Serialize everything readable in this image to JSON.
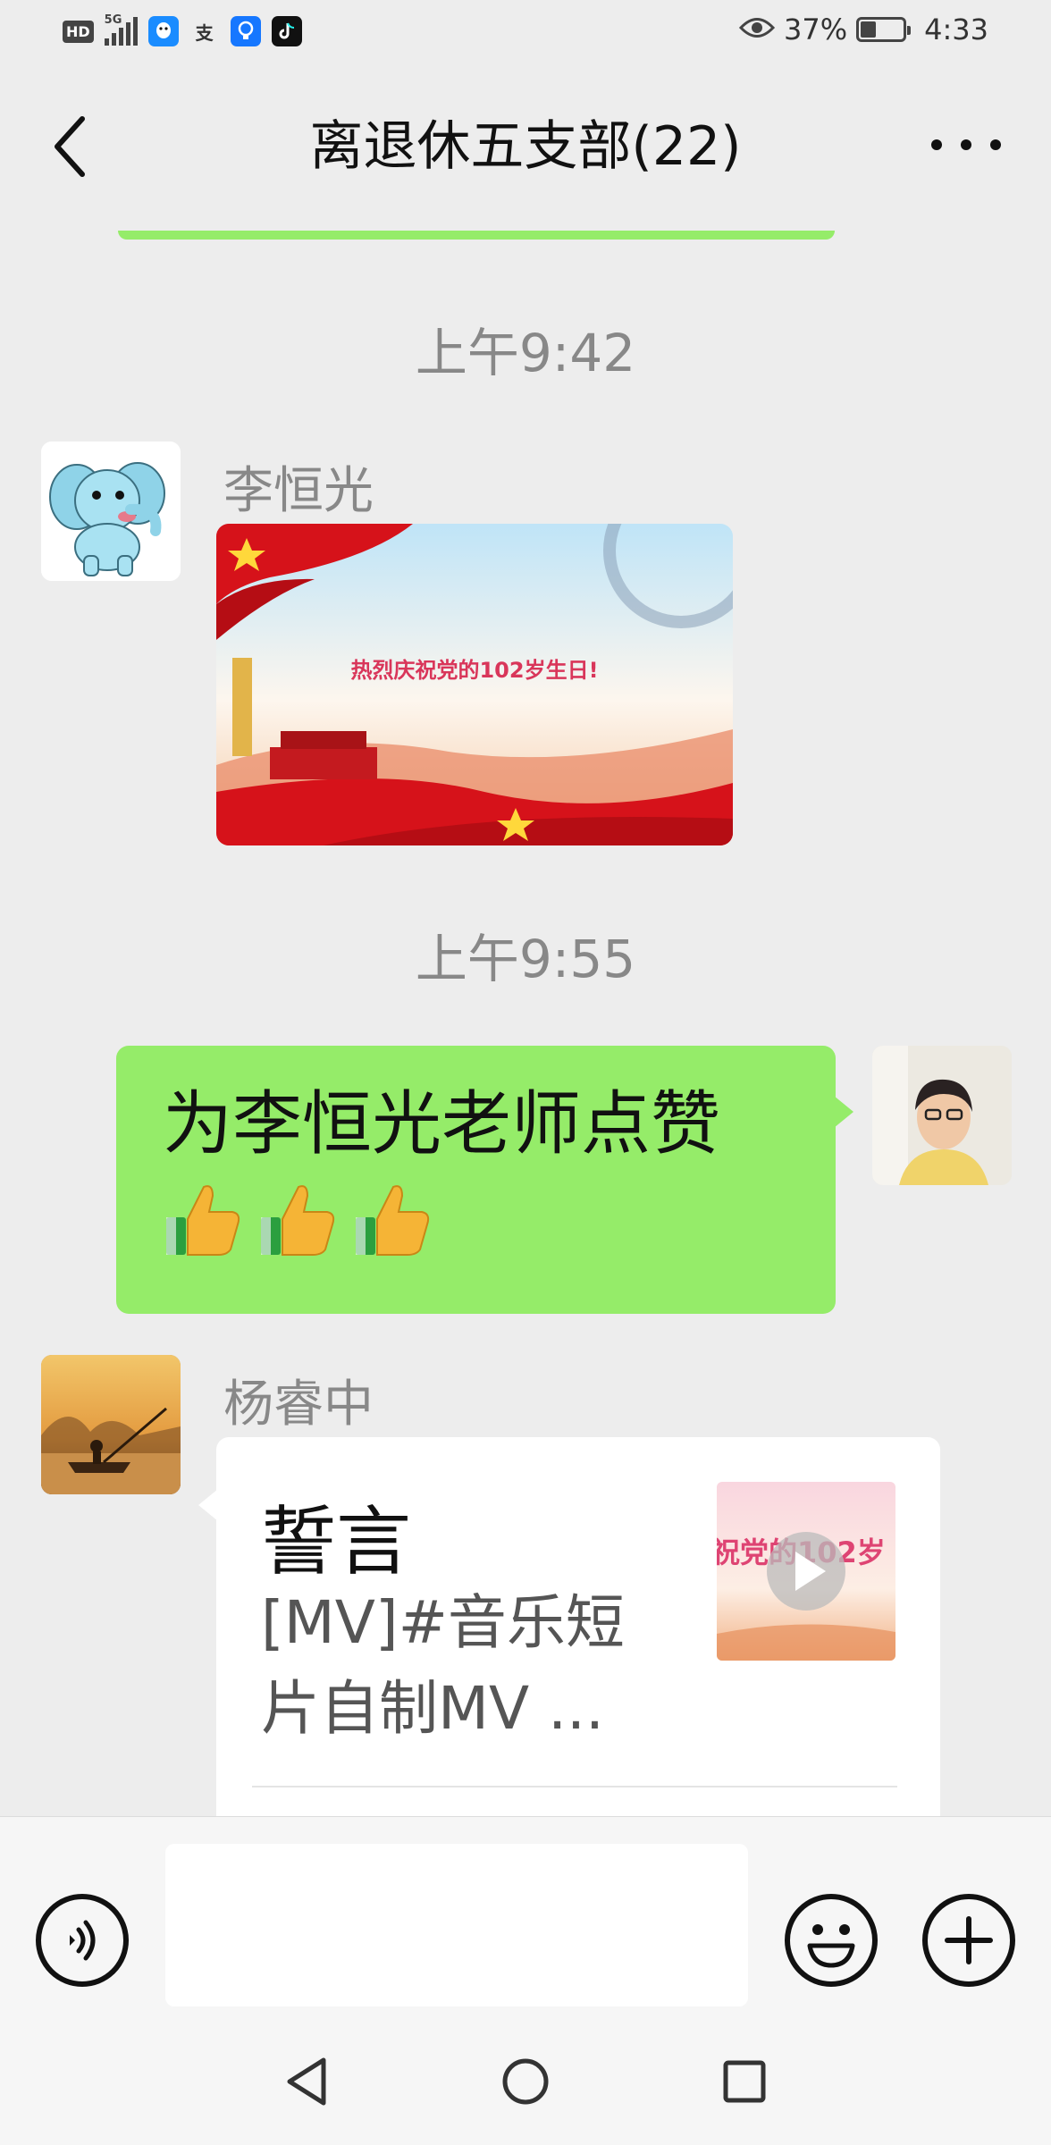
{
  "status_bar": {
    "hd": "HD",
    "network": "5G",
    "alipay_icon_char": "支",
    "battery_percent": "37%",
    "time": "4:33",
    "battery_level": 0.37
  },
  "header": {
    "title": "离退休五支部(22)"
  },
  "messages": {
    "time_1": "上午9:42",
    "sender_1": "李恒光",
    "image_caption": "热烈庆祝党的102岁生日!",
    "time_2": "上午9:55",
    "my_text": "为李恒光老师点赞",
    "sender_2": "杨睿中",
    "card_title": "誓言",
    "card_desc": "[MV]#音乐短片自制MV ...",
    "card_thumb_text": "祝党的102岁"
  },
  "input": {
    "placeholder": ""
  },
  "colors": {
    "bubble_green": "#95ec69",
    "background": "#ededed"
  }
}
